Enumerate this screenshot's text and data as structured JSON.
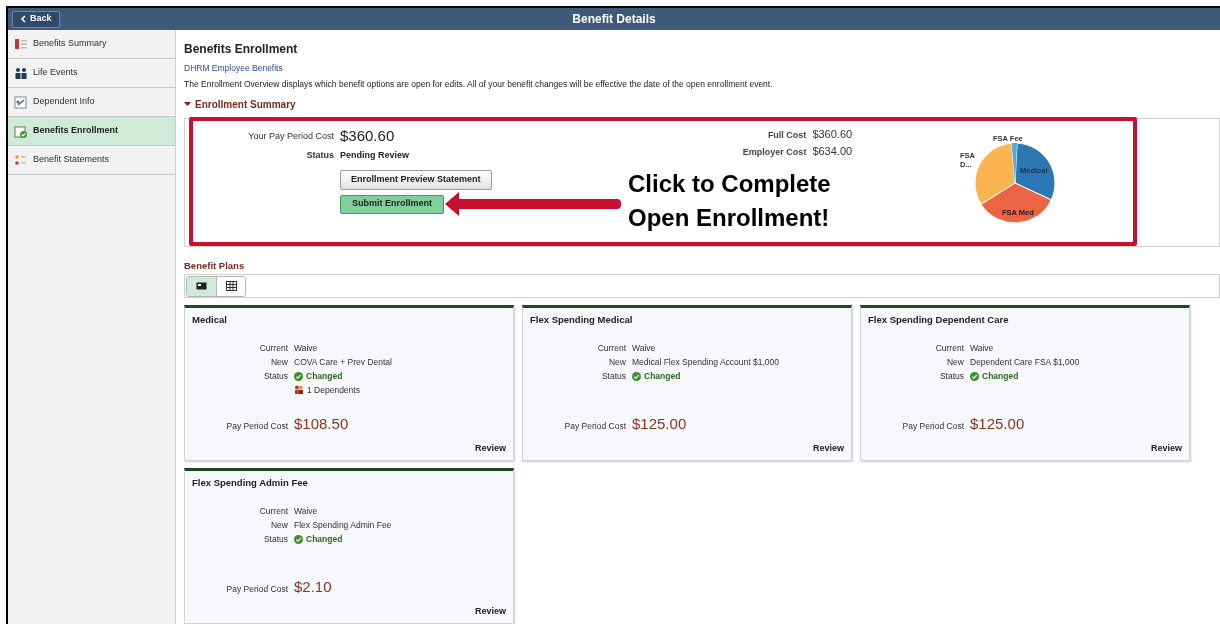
{
  "header": {
    "back_button": "Back",
    "title": "Benefit Details"
  },
  "sidebar": {
    "items": [
      {
        "label": "Benefits Summary",
        "selected": false
      },
      {
        "label": "Life Events",
        "selected": false
      },
      {
        "label": "Dependent Info",
        "selected": false
      },
      {
        "label": "Benefits Enrollment",
        "selected": true
      },
      {
        "label": "Benefit Statements",
        "selected": false
      }
    ]
  },
  "page": {
    "title": "Benefits Enrollment",
    "link": "DHRM Employee Benefits",
    "description": "The Enrollment Overview displays which benefit options are open for edits. All of your benefit changes will be effective the date of the open enrollment event."
  },
  "enrollment_summary": {
    "heading": "Enrollment Summary",
    "expanded": true,
    "pay_period_cost_label": "Your Pay Period Cost",
    "pay_period_cost": "$360.60",
    "status_label": "Status",
    "status": "Pending Review",
    "preview_button": "Enrollment Preview Statement",
    "submit_button": "Submit Enrollment",
    "full_cost_label": "Full Cost",
    "full_cost": "$360.60",
    "employer_cost_label": "Employer Cost",
    "employer_cost": "$634.00",
    "chart_slices": [
      {
        "label": "Medical",
        "color": "#2b78b4"
      },
      {
        "label": "FSA Med",
        "color": "#ec6444"
      },
      {
        "label": "FSA D...",
        "color": "#fbb450"
      },
      {
        "label": "FSA Fee",
        "color": "#5ba9d9"
      }
    ]
  },
  "callout": {
    "lines": [
      "Click to Complete",
      "Open Enrollment!"
    ]
  },
  "benefit_plans": {
    "heading": "Benefit Plans",
    "views": [
      {
        "kind": "tiles",
        "selected": true
      },
      {
        "kind": "grid",
        "selected": false
      }
    ],
    "cards": [
      {
        "title": "Medical",
        "rows": [
          {
            "kind": "text",
            "label": "Current",
            "value": "Waive"
          },
          {
            "kind": "text",
            "label": "New",
            "value": "COVA Care + Prev Dental"
          },
          {
            "kind": "changed",
            "label": "Status",
            "value": "Changed"
          },
          {
            "kind": "dependents",
            "label": "",
            "value": "1 Dependents"
          }
        ],
        "cost_label": "Pay Period Cost",
        "cost": "$108.50",
        "review": "Review"
      },
      {
        "title": "Flex Spending Medical",
        "rows": [
          {
            "kind": "text",
            "label": "Current",
            "value": "Waive"
          },
          {
            "kind": "text",
            "label": "New",
            "value": "Medical Flex Spending Account $1,000"
          },
          {
            "kind": "changed",
            "label": "Status",
            "value": "Changed"
          }
        ],
        "cost_label": "Pay Period Cost",
        "cost": "$125.00",
        "review": "Review"
      },
      {
        "title": "Flex Spending Dependent Care",
        "rows": [
          {
            "kind": "text",
            "label": "Current",
            "value": "Waive"
          },
          {
            "kind": "text",
            "label": "New",
            "value": "Dependent Care FSA $1,000"
          },
          {
            "kind": "changed",
            "label": "Status",
            "value": "Changed"
          }
        ],
        "cost_label": "Pay Period Cost",
        "cost": "$125.00",
        "review": "Review"
      },
      {
        "title": "Flex Spending Admin Fee",
        "rows": [
          {
            "kind": "text",
            "label": "Current",
            "value": "Waive"
          },
          {
            "kind": "text",
            "label": "New",
            "value": "Flex Spending Admin Fee"
          },
          {
            "kind": "changed",
            "label": "Status",
            "value": "Changed"
          }
        ],
        "cost_label": "Pay Period Cost",
        "cost": "$2.10",
        "review": "Review"
      }
    ]
  }
}
